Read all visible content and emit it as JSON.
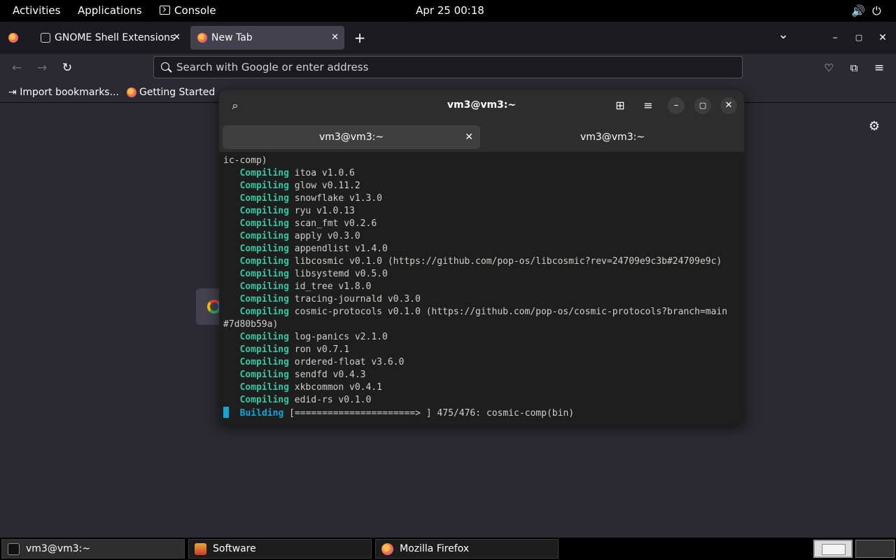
{
  "topbar": {
    "activities": "Activities",
    "applications": "Applications",
    "console": "Console",
    "datetime": "Apr 25  00:18"
  },
  "firefox": {
    "tabs": [
      {
        "label": "GNOME Shell Extensions",
        "close": "✕"
      },
      {
        "label": "New Tab",
        "close": "✕"
      }
    ],
    "new_tab": "+",
    "tab_list": "⌄",
    "minimize": "–",
    "maximize": "▢",
    "close": "✕",
    "urlbar_placeholder": "Search with Google or enter address",
    "bookmarks": [
      {
        "label": "Import bookmarks..."
      },
      {
        "label": "Getting Started"
      }
    ]
  },
  "terminal": {
    "title": "vm3@vm3:~",
    "tabs": [
      {
        "label": "vm3@vm3:~",
        "close": "✕"
      },
      {
        "label": "vm3@vm3:~"
      }
    ],
    "lines": [
      {
        "kind": "plain",
        "text": "ic-comp)"
      },
      {
        "kind": "compiling",
        "kw": "Compiling",
        "text": "itoa v1.0.6"
      },
      {
        "kind": "compiling",
        "kw": "Compiling",
        "text": "glow v0.11.2"
      },
      {
        "kind": "compiling",
        "kw": "Compiling",
        "text": "snowflake v1.3.0"
      },
      {
        "kind": "compiling",
        "kw": "Compiling",
        "text": "ryu v1.0.13"
      },
      {
        "kind": "compiling",
        "kw": "Compiling",
        "text": "scan_fmt v0.2.6"
      },
      {
        "kind": "compiling",
        "kw": "Compiling",
        "text": "apply v0.3.0"
      },
      {
        "kind": "compiling",
        "kw": "Compiling",
        "text": "appendlist v1.4.0"
      },
      {
        "kind": "compiling",
        "kw": "Compiling",
        "text": "libcosmic v0.1.0 (https://github.com/pop-os/libcosmic?rev=24709e9c3b#24709e9c)"
      },
      {
        "kind": "compiling",
        "kw": "Compiling",
        "text": "libsystemd v0.5.0"
      },
      {
        "kind": "compiling",
        "kw": "Compiling",
        "text": "id_tree v1.8.0"
      },
      {
        "kind": "compiling",
        "kw": "Compiling",
        "text": "tracing-journald v0.3.0"
      },
      {
        "kind": "compiling",
        "kw": "Compiling",
        "text": "cosmic-protocols v0.1.0 (https://github.com/pop-os/cosmic-protocols?branch=main"
      },
      {
        "kind": "plain",
        "text": "#7d80b59a)"
      },
      {
        "kind": "compiling",
        "kw": "Compiling",
        "text": "log-panics v2.1.0"
      },
      {
        "kind": "compiling",
        "kw": "Compiling",
        "text": "ron v0.7.1"
      },
      {
        "kind": "compiling",
        "kw": "Compiling",
        "text": "ordered-float v3.6.0"
      },
      {
        "kind": "compiling",
        "kw": "Compiling",
        "text": "sendfd v0.4.3"
      },
      {
        "kind": "compiling",
        "kw": "Compiling",
        "text": "xkbcommon v0.4.1"
      },
      {
        "kind": "compiling",
        "kw": "Compiling",
        "text": "edid-rs v0.1.0"
      },
      {
        "kind": "building",
        "kw": "Building",
        "text": "[======================> ] 475/476: cosmic-comp(bin)"
      }
    ]
  },
  "taskbar": {
    "items": [
      {
        "label": "vm3@vm3:~"
      },
      {
        "label": "Software"
      },
      {
        "label": "Mozilla Firefox"
      }
    ]
  },
  "icons": {
    "volume": "volume-icon",
    "power": "power-icon",
    "search": "search-icon",
    "gear": "gear-icon"
  },
  "colors": {
    "terminal_green": "#33c7a3",
    "terminal_blue": "#12a5d8",
    "firefox_bg": "#2b2a33"
  }
}
